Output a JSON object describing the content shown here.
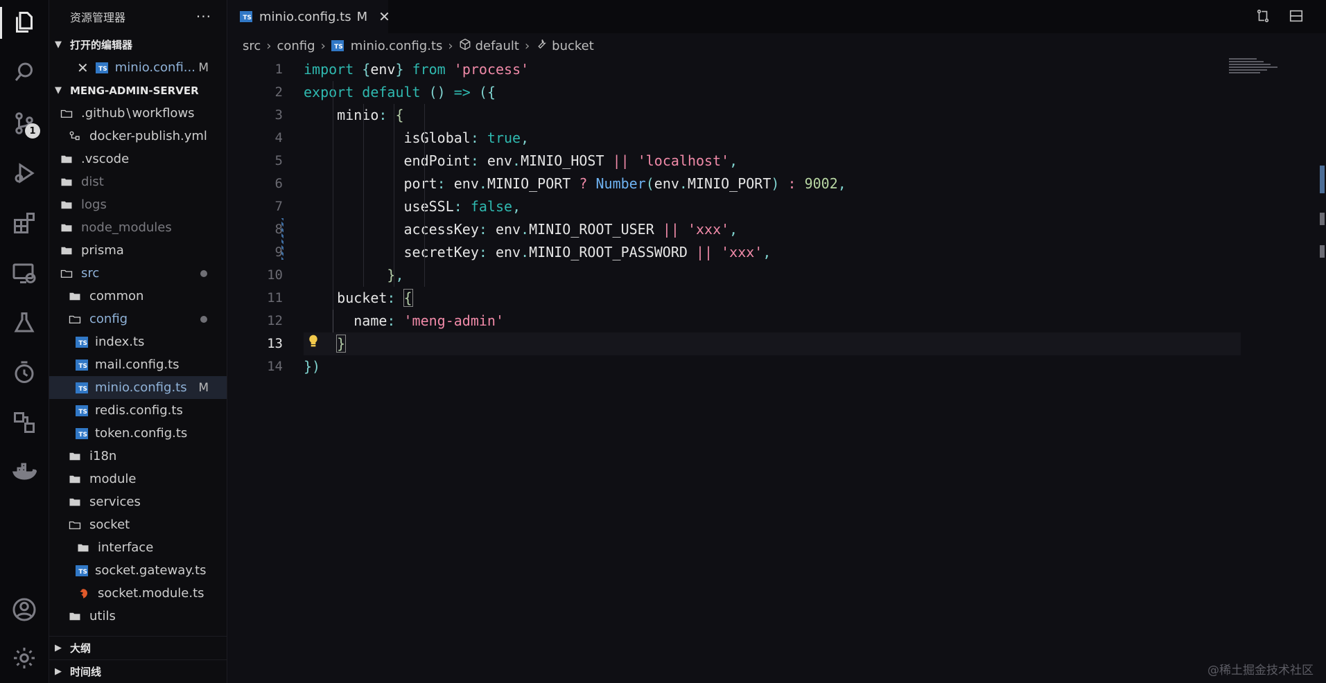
{
  "explorer": {
    "title": "资源管理器",
    "more": "···",
    "open_editors_label": "打开的编辑器",
    "open_editor_item": {
      "name": "minio.confi...",
      "flag": "M",
      "icon": "ts-icon"
    },
    "project_label": "MENG-ADMIN-SERVER",
    "tree": [
      {
        "label": ".github",
        "label2": "workflows",
        "type": "folder-open",
        "indent": 0,
        "style": "normal"
      },
      {
        "label": "docker-publish.yml",
        "type": "yml",
        "indent": 1,
        "style": "normal"
      },
      {
        "label": ".vscode",
        "type": "folder",
        "indent": 0,
        "style": "normal"
      },
      {
        "label": "dist",
        "type": "folder",
        "indent": 0,
        "style": "dim"
      },
      {
        "label": "logs",
        "type": "folder",
        "indent": 0,
        "style": "dim"
      },
      {
        "label": "node_modules",
        "type": "folder",
        "indent": 0,
        "style": "dim"
      },
      {
        "label": "prisma",
        "type": "folder",
        "indent": 0,
        "style": "normal"
      },
      {
        "label": "src",
        "type": "folder-open",
        "indent": 0,
        "style": "blue",
        "dot": true
      },
      {
        "label": "common",
        "type": "folder",
        "indent": 1,
        "style": "normal"
      },
      {
        "label": "config",
        "type": "folder-open",
        "indent": 1,
        "style": "blue",
        "dot": true
      },
      {
        "label": "index.ts",
        "type": "ts",
        "indent": 2,
        "style": "normal"
      },
      {
        "label": "mail.config.ts",
        "type": "ts",
        "indent": 2,
        "style": "normal"
      },
      {
        "label": "minio.config.ts",
        "type": "ts",
        "indent": 2,
        "style": "blue",
        "flag": "M",
        "selected": true
      },
      {
        "label": "redis.config.ts",
        "type": "ts",
        "indent": 2,
        "style": "normal"
      },
      {
        "label": "token.config.ts",
        "type": "ts",
        "indent": 2,
        "style": "normal"
      },
      {
        "label": "i18n",
        "type": "folder",
        "indent": 1,
        "style": "normal"
      },
      {
        "label": "module",
        "type": "folder",
        "indent": 1,
        "style": "normal"
      },
      {
        "label": "services",
        "type": "folder",
        "indent": 1,
        "style": "normal"
      },
      {
        "label": "socket",
        "type": "folder-open",
        "indent": 1,
        "style": "normal"
      },
      {
        "label": "interface",
        "type": "folder",
        "indent": 2,
        "style": "normal"
      },
      {
        "label": "socket.gateway.ts",
        "type": "ts",
        "indent": 2,
        "style": "normal"
      },
      {
        "label": "socket.module.ts",
        "type": "nest",
        "indent": 2,
        "style": "normal"
      },
      {
        "label": "utils",
        "type": "folder",
        "indent": 1,
        "style": "normal"
      }
    ],
    "outline_label": "大纲",
    "timeline_label": "时间线"
  },
  "activity": {
    "scm_badge": "1"
  },
  "tab": {
    "label": "minio.config.ts",
    "flag": "M",
    "close": "✕"
  },
  "breadcrumb": [
    "src",
    "config",
    "minio.config.ts",
    "default",
    "bucket"
  ],
  "editor": {
    "current_line": 13,
    "line_numbers": [
      "1",
      "2",
      "3",
      "4",
      "5",
      "6",
      "7",
      "8",
      "9",
      "10",
      "11",
      "12",
      "13",
      "14"
    ]
  },
  "watermark": "@稀土掘金技术社区",
  "colors": {
    "ts_blue": "#3178c6",
    "keyword": "#2fb9b0",
    "string": "#f08aa8"
  }
}
